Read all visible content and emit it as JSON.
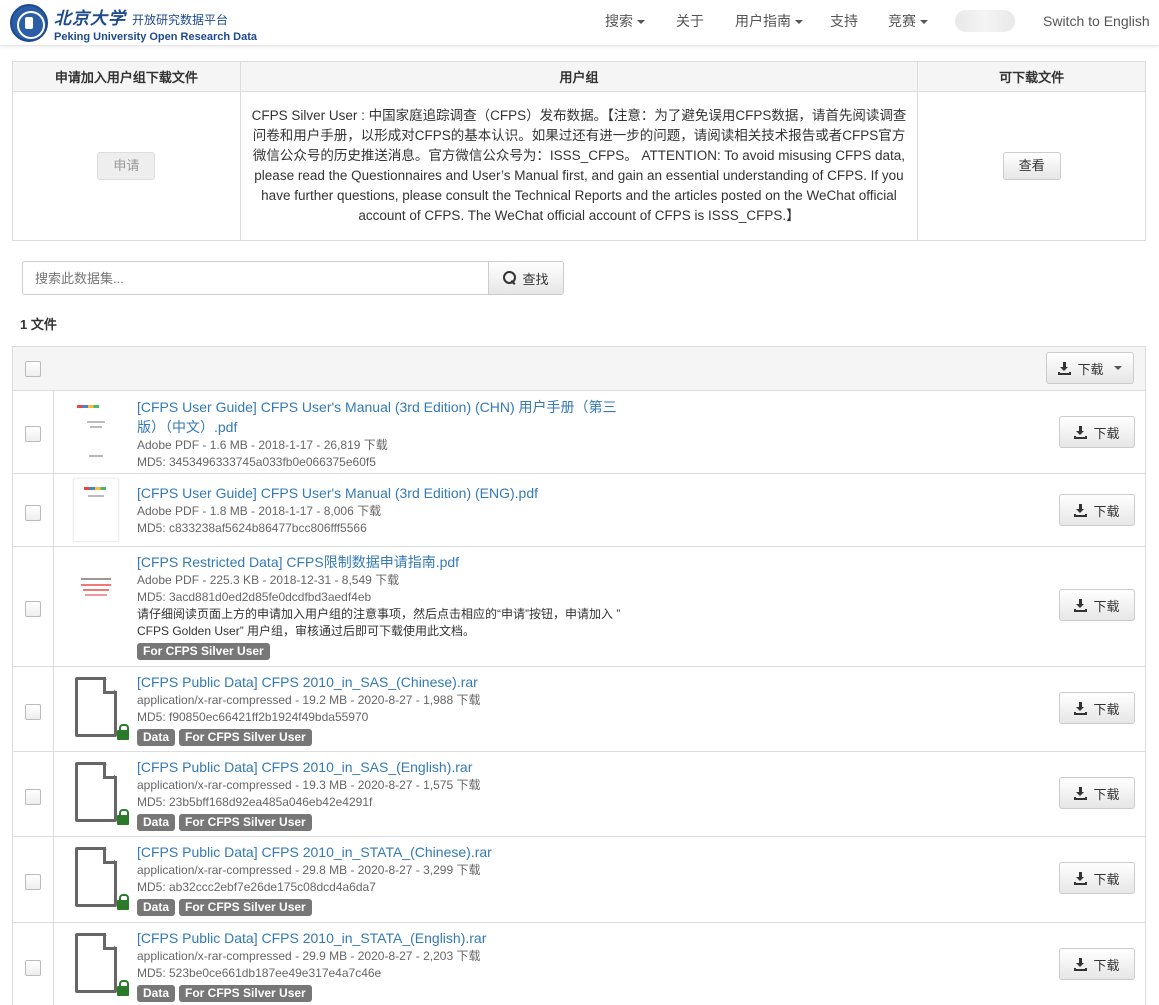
{
  "brand": {
    "cn_name": "北京大学",
    "cn_sub": "开放研究数据平台",
    "en_name": "Peking University Open Research Data"
  },
  "nav": {
    "search": "搜索",
    "about": "关于",
    "guide": "用户指南",
    "support": "支持",
    "contest": "竞赛",
    "lang": "Switch to English"
  },
  "access": {
    "headers": [
      "申请加入用户组下载文件",
      "用户组",
      "可下载文件"
    ],
    "apply_label": "申请",
    "group_desc": "CFPS Silver User : 中国家庭追踪调查（CFPS）发布数据。【注意：为了避免误用CFPS数据，请首先阅读调查问卷和用户手册，以形成对CFPS的基本认识。如果过还有进一步的问题，请阅读相关技术报告或者CFPS官方微信公众号的历史推送消息。官方微信公众号为：ISSS_CFPS。 ATTENTION: To avoid misusing CFPS data, please read the Questionnaires and User’s Manual first, and gain an essential understanding of CFPS. If you have further questions, please consult the Technical Reports and the articles posted on the WeChat official account of CFPS. The WeChat official account of CFPS is ISSS_CFPS.】",
    "view_label": "查看"
  },
  "search": {
    "placeholder": "搜索此数据集...",
    "button": "查找"
  },
  "file_count": "1 文件",
  "download_all": "下载",
  "download_label": "下载",
  "files": [
    {
      "name": "[CFPS User Guide] CFPS User's Manual (3rd Edition) (CHN) 用户手册（第三版）（中文）.pdf",
      "meta": "Adobe PDF - 1.6 MB - 2018-1-17 - 26,819 下载",
      "md5": "MD5: 3453496333745a033fb0e066375e60f5"
    },
    {
      "name": "[CFPS User Guide] CFPS User's Manual (3rd Edition) (ENG).pdf",
      "meta": "Adobe PDF - 1.8 MB - 2018-1-17 - 8,006 下载",
      "md5": "MD5: c833238af5624b86477bcc806fff5566"
    },
    {
      "name": "[CFPS Restricted Data] CFPS限制数据申请指南.pdf",
      "meta": "Adobe PDF - 225.3 KB - 2018-12-31 - 8,549 下载",
      "md5": "MD5: 3acd881d0ed2d85fe0dcdfbd3aedf4eb",
      "desc1": "请仔细阅读页面上方的申请加入用户组的注意事项，然后点击相应的“申请”按钮，申请加入 ”",
      "desc2": "CFPS Golden User” 用户组，审核通过后即可下载使用此文档。",
      "tag1": "For CFPS Silver User"
    },
    {
      "name": "[CFPS Public Data] CFPS 2010_in_SAS_(Chinese).rar",
      "meta": "application/x-rar-compressed - 19.2 MB - 2020-8-27 - 1,988 下载",
      "md5": "MD5: f90850ec66421ff2b1924f49bda55970",
      "tag1": "Data",
      "tag2": "For CFPS Silver User"
    },
    {
      "name": "[CFPS Public Data] CFPS 2010_in_SAS_(English).rar",
      "meta": "application/x-rar-compressed - 19.3 MB - 2020-8-27 - 1,575 下载",
      "md5": "MD5: 23b5bff168d92ea485a046eb42e4291f",
      "tag1": "Data",
      "tag2": "For CFPS Silver User"
    },
    {
      "name": "[CFPS Public Data] CFPS 2010_in_STATA_(Chinese).rar",
      "meta": "application/x-rar-compressed - 29.8 MB - 2020-8-27 - 3,299 下载",
      "md5": "MD5: ab32ccc2ebf7e26de175c08dcd4a6da7",
      "tag1": "Data",
      "tag2": "For CFPS Silver User"
    },
    {
      "name": "[CFPS Public Data] CFPS 2010_in_STATA_(English).rar",
      "meta": "application/x-rar-compressed - 29.9 MB - 2020-8-27 - 2,203 下载",
      "md5": "MD5: 523be0ce661db187ee49e317e4a7c46e",
      "tag1": "Data",
      "tag2": "For CFPS Silver User"
    }
  ]
}
